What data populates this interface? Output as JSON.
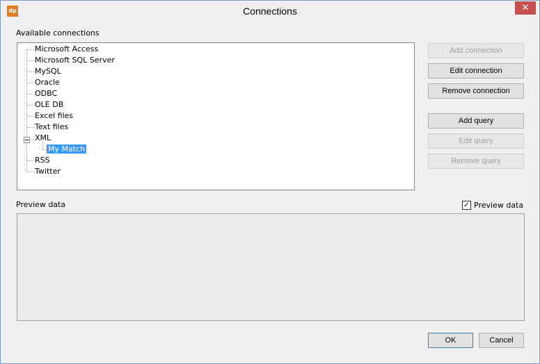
{
  "window": {
    "title": "Connections",
    "app_icon_text": "dp",
    "close_symbol": "✕"
  },
  "available_connections": {
    "label": "Available connections",
    "items": [
      {
        "label": "Microsoft Access"
      },
      {
        "label": "Microsoft SQL Server"
      },
      {
        "label": "MySQL"
      },
      {
        "label": "Oracle"
      },
      {
        "label": "ODBC"
      },
      {
        "label": "OLE DB"
      },
      {
        "label": "Excel files"
      },
      {
        "label": "Text files"
      },
      {
        "label": "XML",
        "expanded": true,
        "children": [
          {
            "label": "My Match",
            "selected": true
          }
        ]
      },
      {
        "label": "RSS"
      },
      {
        "label": "Twitter"
      }
    ]
  },
  "buttons": {
    "add_connection": "Add connection",
    "edit_connection": "Edit connection",
    "remove_connection": "Remove connection",
    "add_query": "Add query",
    "edit_query": "Edit query",
    "remove_query": "Remove query",
    "ok": "OK",
    "cancel": "Cancel"
  },
  "preview": {
    "label": "Preview data",
    "checkbox_label": "Preview data",
    "checked": true,
    "check_symbol": "✓"
  }
}
